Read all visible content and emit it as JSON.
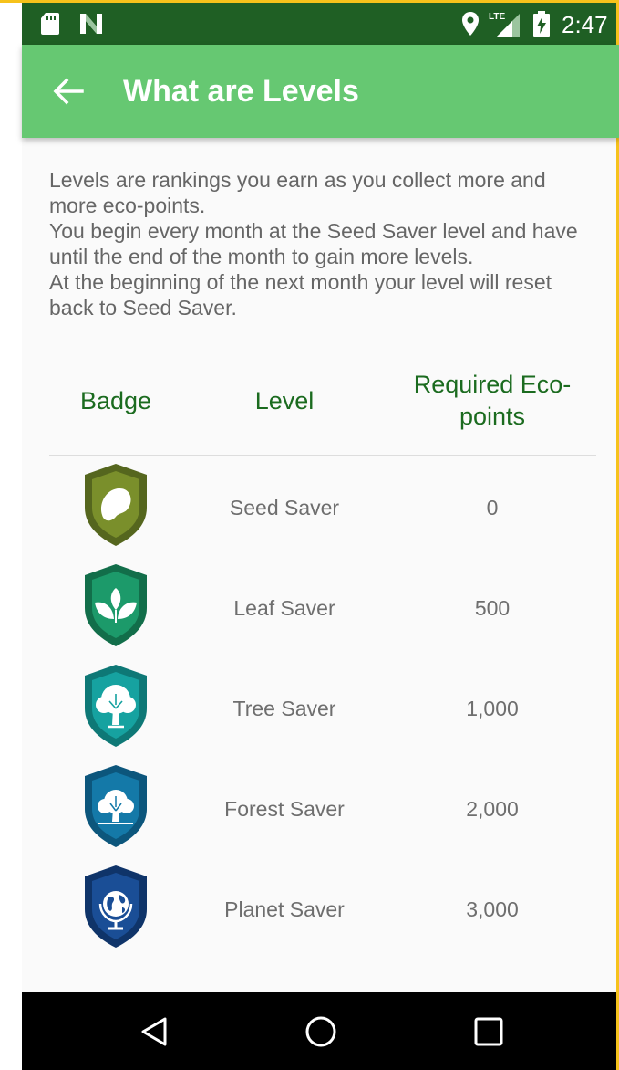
{
  "status_bar": {
    "time": "2:47",
    "network_label": "LTE",
    "icons": [
      "sd-card-icon",
      "n-notification-icon",
      "location-icon",
      "lte-signal-icon",
      "battery-charging-icon"
    ]
  },
  "app_bar": {
    "title": "What are Levels",
    "back_icon": "arrow-back-icon"
  },
  "intro": {
    "paragraphs": [
      "Levels are rankings you earn as you collect more and more eco-points.",
      "You begin every month at the Seed Saver level and have until the end of the month to gain more levels.",
      "At the beginning of the next month your level will reset back to Seed Saver."
    ]
  },
  "table": {
    "headers": {
      "badge": "Badge",
      "level": "Level",
      "points": "Required Eco-points"
    },
    "rows": [
      {
        "level": "Seed Saver",
        "points": "0",
        "badge_icon": "seed-badge-icon",
        "color": "#7a8f2b"
      },
      {
        "level": "Leaf Saver",
        "points": "500",
        "badge_icon": "leaf-badge-icon",
        "color": "#1c9a6a"
      },
      {
        "level": "Tree Saver",
        "points": "1,000",
        "badge_icon": "tree-badge-icon",
        "color": "#16a2a0"
      },
      {
        "level": "Forest Saver",
        "points": "2,000",
        "badge_icon": "forest-badge-icon",
        "color": "#1479a8"
      },
      {
        "level": "Planet Saver",
        "points": "3,000",
        "badge_icon": "planet-badge-icon",
        "color": "#1a4e96"
      }
    ]
  },
  "nav_bar": {
    "icons": [
      "nav-back-icon",
      "nav-home-icon",
      "nav-recents-icon"
    ]
  },
  "colors": {
    "status_bar": "#1f5f24",
    "app_bar": "#66c872",
    "header_text": "#1b6b1f",
    "body_text": "#666666"
  }
}
